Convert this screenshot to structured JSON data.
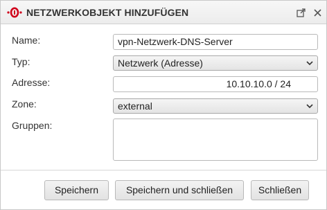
{
  "dialog": {
    "title": "NETZWERKOBJEKT HINZUFÜGEN",
    "brand_color": "#d0021b",
    "icons": [
      "logo-icon",
      "popout-icon",
      "close-icon"
    ]
  },
  "form": {
    "name": {
      "label": "Name:",
      "value": "vpn-Netzwerk-DNS-Server"
    },
    "typ": {
      "label": "Typ:",
      "value": "Netzwerk (Adresse)"
    },
    "adresse": {
      "label": "Adresse:",
      "value": "10.10.10.0 / 24"
    },
    "zone": {
      "label": "Zone:",
      "value": "external"
    },
    "gruppen": {
      "label": "Gruppen:",
      "value": ""
    }
  },
  "buttons": {
    "save": "Speichern",
    "save_close": "Speichern und schließen",
    "close": "Schließen"
  }
}
